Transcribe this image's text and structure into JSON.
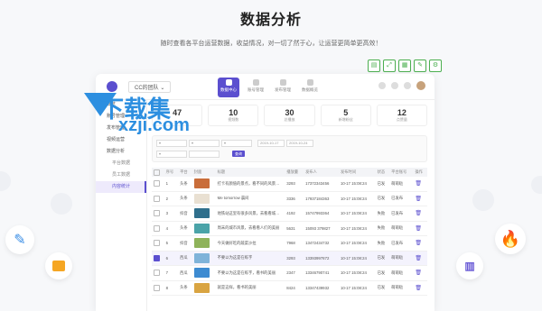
{
  "hero": {
    "title": "数据分析",
    "subtitle": "随时查看各平台运营数据，收益情况，对一切了然于心，让运营更简单更高效！"
  },
  "watermark": {
    "line1": "下载集",
    "line2": "xzji.com"
  },
  "app": {
    "team": "CC的团队 ⌄",
    "nav": [
      "数据中心",
      "账号管理",
      "发布管理",
      "数据概览"
    ],
    "sidebar": [
      "概览",
      "账号管理",
      "发布管理",
      "视频运营",
      "数据分析",
      "平台数据",
      "员工数据",
      "内容统计"
    ],
    "stats": [
      {
        "value": "47",
        "label": ""
      },
      {
        "value": "10",
        "label": "视频数"
      },
      {
        "value": "30",
        "label": "总播放"
      },
      {
        "value": "5",
        "label": "新增粉丝"
      },
      {
        "value": "12",
        "label": "点赞量"
      }
    ],
    "filters": {
      "date_start": "2019-10-17",
      "date_end": "2019-10-24",
      "search_label": "查询"
    },
    "table": {
      "headers": [
        "",
        "序号",
        "平台",
        "封面",
        "标题",
        "播放量",
        "发布人",
        "发布时间",
        "状态",
        "平台账号",
        "操作"
      ],
      "rows": [
        {
          "no": "1",
          "platform": "头条",
          "title": "打卡有颜值的景点，看不同的风景旅行",
          "plays": "3293",
          "phone": "17372343456",
          "time": "10-17 15:08:24",
          "status": "已发",
          "account": "萌萌哒",
          "thumb": "#c96d3a"
        },
        {
          "no": "2",
          "platform": "头条",
          "title": "Me tomorrow 晨间",
          "plays": "3336",
          "phone": "17937184363",
          "time": "10-17 15:08:24",
          "status": "已发",
          "account": "已发布",
          "thumb": "#e9e0d2"
        },
        {
          "no": "3",
          "platform": "抖音",
          "title": "地铁站这里有很多风景，去看看城市的风景",
          "plays": "4192",
          "phone": "15747993364",
          "time": "10-17 15:08:24",
          "status": "失败",
          "account": "已发布",
          "thumb": "#2f6f8c"
        },
        {
          "no": "4",
          "platform": "头条",
          "title": "周末的城市风景，去看看人们的美丽",
          "plays": "5631",
          "phone": "15093 379827",
          "time": "10-17 15:08:24",
          "status": "失败",
          "account": "萌萌哒",
          "thumb": "#4aa3a8"
        },
        {
          "no": "5",
          "platform": "抖音",
          "title": "今天做好吃的蔬菜沙拉",
          "plays": "7968",
          "phone": "13472434732",
          "time": "10-17 15:08:24",
          "status": "失败",
          "account": "已发布",
          "thumb": "#8fb35a"
        },
        {
          "no": "6",
          "platform": "西瓜",
          "title": "不要以为这是在练字",
          "plays": "3293",
          "phone": "13393997872",
          "time": "10-17 15:08:24",
          "status": "已发",
          "account": "萌萌哒",
          "thumb": "#7fb3d9"
        },
        {
          "no": "7",
          "platform": "西瓜",
          "title": "不要以为这是在练字，看书的美丽",
          "plays": "2347",
          "phone": "13346790741",
          "time": "10-17 15:08:24",
          "status": "已发",
          "account": "萌萌哒",
          "thumb": "#3d8bd1"
        },
        {
          "no": "8",
          "platform": "头条",
          "title": "就是这样，看书的美丽",
          "plays": "8424",
          "phone": "13347439932",
          "time": "10-17 15:08:24",
          "status": "已发",
          "account": "萌萌哒",
          "thumb": "#d9a441"
        }
      ]
    }
  },
  "colors": {
    "accent": "#5b4fcf",
    "watermark": "#2d8fe0"
  }
}
